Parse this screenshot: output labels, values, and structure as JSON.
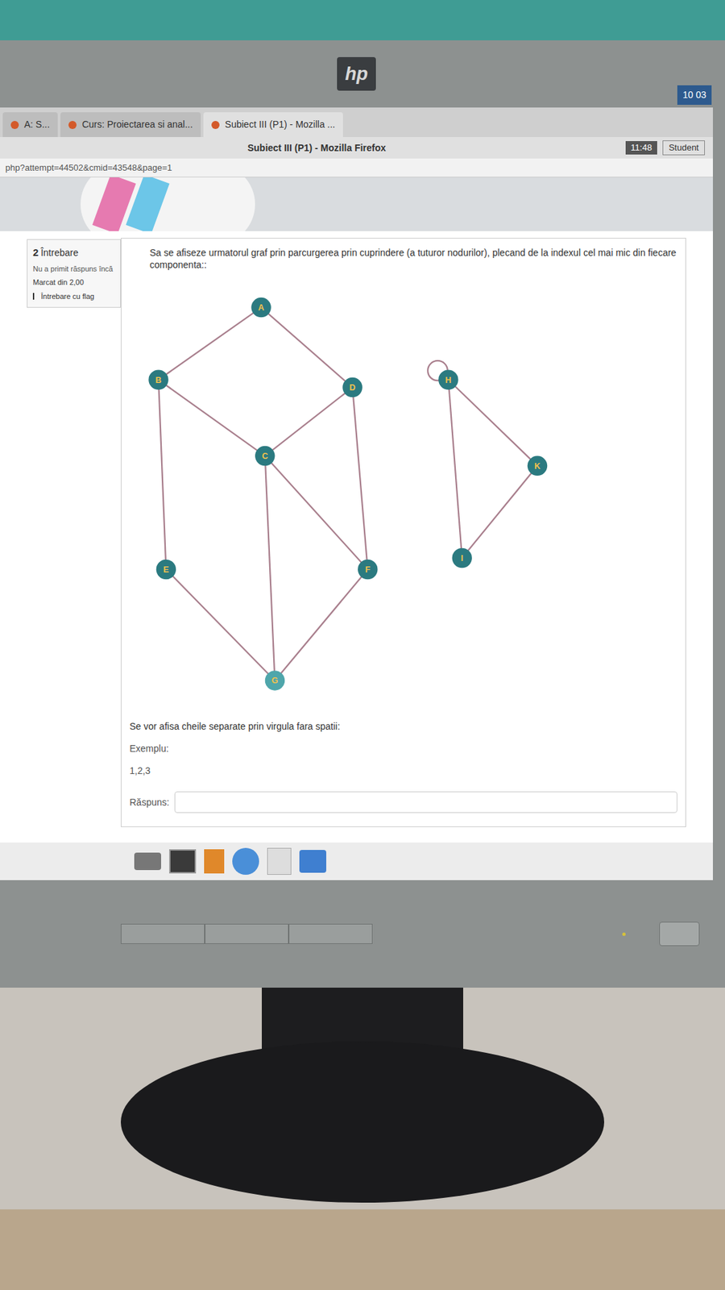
{
  "monitor": {
    "brand": "hp",
    "corner_badge": "10 03"
  },
  "browser": {
    "tabs": [
      {
        "label": "A: S...",
        "selected": false
      },
      {
        "label": "Curs: Proiectarea si anal...",
        "selected": false
      },
      {
        "label": "Subiect III (P1) - Mozilla ...",
        "selected": true
      }
    ],
    "title": "Subiect III (P1) - Mozilla Firefox",
    "clock": "11:48",
    "user": "Student",
    "url": "php?attempt=44502&cmid=43548&page=1"
  },
  "question": {
    "number": "2",
    "label": "Întrebare",
    "status": "Nu a primit răspuns încă",
    "mark": "Marcat din 2,00",
    "flag": "Întrebare cu flag",
    "text": "Sa se afiseze urmatorul graf prin parcurgerea prin cuprindere (a tuturor nodurilor), plecand de la indexul cel mai mic din fiecare componenta::",
    "instructions": "Se vor afisa cheile separate prin virgula fara spatii:",
    "example_label": "Exemplu:",
    "example": "1,2,3",
    "answer_label": "Răspuns:",
    "answer": ""
  },
  "graph": {
    "nodes": [
      {
        "label": "A",
        "color": "#2b7a80"
      },
      {
        "label": "B",
        "color": "#2b7a80"
      },
      {
        "label": "D",
        "color": "#2b7a80"
      },
      {
        "label": "C",
        "color": "#2b7a80"
      },
      {
        "label": "E",
        "color": "#2b7a80"
      },
      {
        "label": "F",
        "color": "#2b7a80"
      },
      {
        "label": "G",
        "color": "#4fa6ab"
      },
      {
        "label": "H",
        "color": "#2b7a80"
      },
      {
        "label": "K",
        "color": "#2b7a80"
      },
      {
        "label": "I",
        "color": "#2b7a80"
      }
    ],
    "edges": [
      {
        "from": "A",
        "to": "B"
      },
      {
        "from": "A",
        "to": "D"
      },
      {
        "from": "B",
        "to": "C"
      },
      {
        "from": "D",
        "to": "C"
      },
      {
        "from": "B",
        "to": "E"
      },
      {
        "from": "D",
        "to": "F"
      },
      {
        "from": "C",
        "to": "F"
      },
      {
        "from": "C",
        "to": "G"
      },
      {
        "from": "E",
        "to": "G"
      },
      {
        "from": "F",
        "to": "G"
      },
      {
        "from": "H",
        "to": "H"
      },
      {
        "from": "H",
        "to": "K"
      },
      {
        "from": "H",
        "to": "I"
      },
      {
        "from": "K",
        "to": "I"
      }
    ]
  }
}
